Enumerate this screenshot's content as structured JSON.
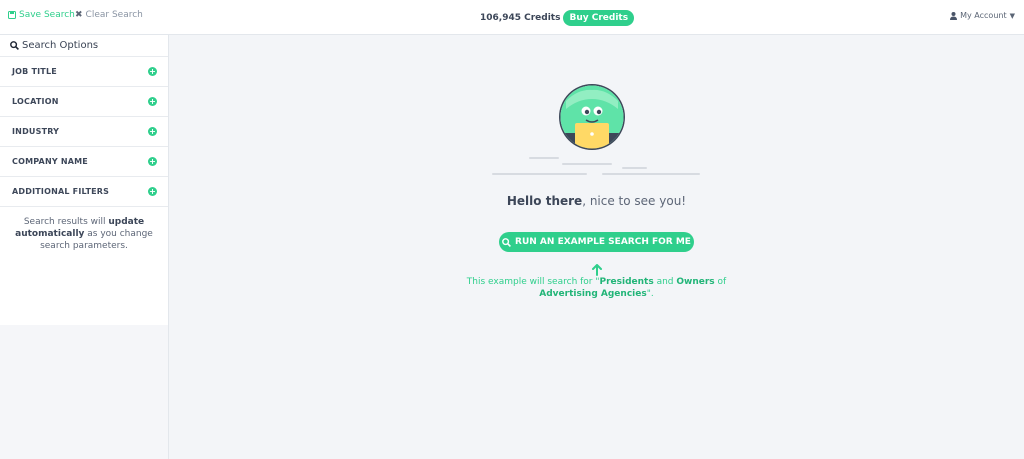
{
  "topbar": {
    "save_search": "Save Search",
    "clear_search": "Clear Search",
    "credits": "106,945 Credits",
    "buy_credits": "Buy Credits",
    "account": "My Account"
  },
  "sidebar": {
    "header": "Search Options",
    "filters": [
      {
        "label": "JOB TITLE"
      },
      {
        "label": "LOCATION"
      },
      {
        "label": "INDUSTRY"
      },
      {
        "label": "COMPANY NAME"
      },
      {
        "label": "ADDITIONAL FILTERS"
      }
    ],
    "note": {
      "part1": "Search results will ",
      "bold1": "update automatically",
      "part2": " as you change search parameters."
    }
  },
  "main": {
    "hello_bold": "Hello there",
    "hello_rest": ", nice to see you!",
    "run_button": "RUN AN EXAMPLE SEARCH FOR ME",
    "example": {
      "p1": "This example will search for \"",
      "b1": "Presidents",
      "p2": " and ",
      "b2": "Owners",
      "p3": " of ",
      "b3": "Advertising Agencies",
      "p4": "\"."
    }
  },
  "colors": {
    "accent": "#2fcf8c",
    "avatar_bg": "#5fe3a8",
    "laptop": "#ffd966",
    "avatar_ring": "#3d4759"
  }
}
